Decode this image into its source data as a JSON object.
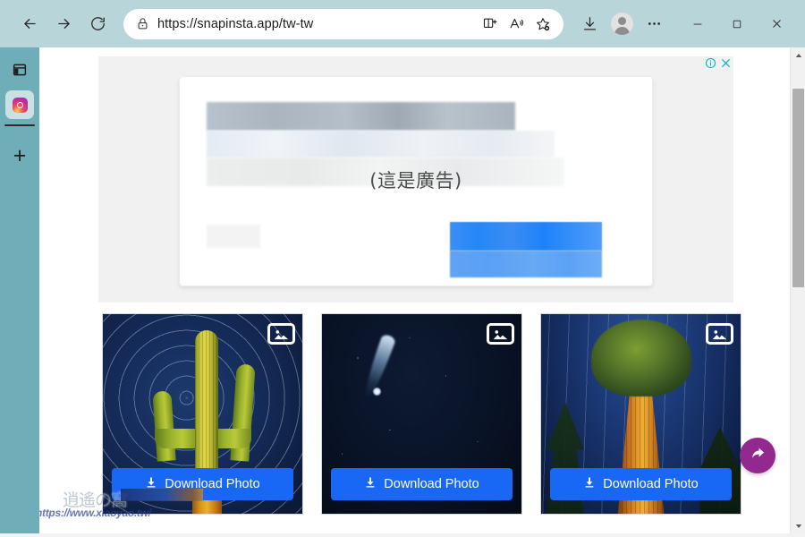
{
  "browser": {
    "nav": {
      "back_label": "Back",
      "forward_label": "Forward",
      "reload_label": "Refresh"
    },
    "omnibox": {
      "url": "https://snapinsta.app/tw-tw",
      "lock_icon": "lock-icon",
      "split_screen_icon": "split-screen-icon",
      "read_aloud_icon": "read-aloud-icon",
      "favorites_icon": "add-favorite-star-icon"
    },
    "toolbar": {
      "downloads_icon": "downloads-icon",
      "profile_icon": "profile-avatar-icon",
      "settings_icon": "more-options-ellipsis-icon"
    },
    "window_controls": {
      "minimize": "minimize-icon",
      "maximize": "maximize-icon",
      "close": "close-icon"
    },
    "tabstrip": {
      "tab_actions_icon": "tab-actions-menu-icon",
      "active_tab_icon": "instagram-favicon",
      "new_tab_label": "+"
    },
    "colors": {
      "chrome_bg": "#B8D5DA",
      "tabstrip_bg": "#6FAEB8",
      "accent_blue": "#1967F5",
      "fab_purple": "#93288F",
      "ad_link_blue": "#00AECD"
    }
  },
  "page": {
    "ad": {
      "label": "(這是廣告)",
      "info_icon": "ad-info-icon",
      "close_icon": "ad-close-icon"
    },
    "cards": [
      {
        "alt": "Saguaro cactus under circular star trails",
        "badge_icon": "image-icon",
        "download_label": "Download Photo",
        "download_icon": "download-icon"
      },
      {
        "alt": "Comet in a dark starry night sky",
        "badge_icon": "image-icon",
        "download_label": "Download Photo",
        "download_icon": "download-icon"
      },
      {
        "alt": "Giant sequoia tree lit at night under stars",
        "badge_icon": "image-icon",
        "download_label": "Download Photo",
        "download_icon": "download-icon"
      }
    ],
    "fab": {
      "icon": "share-arrow-icon",
      "label": "Share"
    },
    "watermark": {
      "logo_text": "逍遙の窩",
      "url": "https://www.xiaoyao.tw/"
    },
    "scrollbar": {
      "up_icon": "scroll-up-arrow",
      "down_icon": "scroll-down-arrow"
    }
  }
}
